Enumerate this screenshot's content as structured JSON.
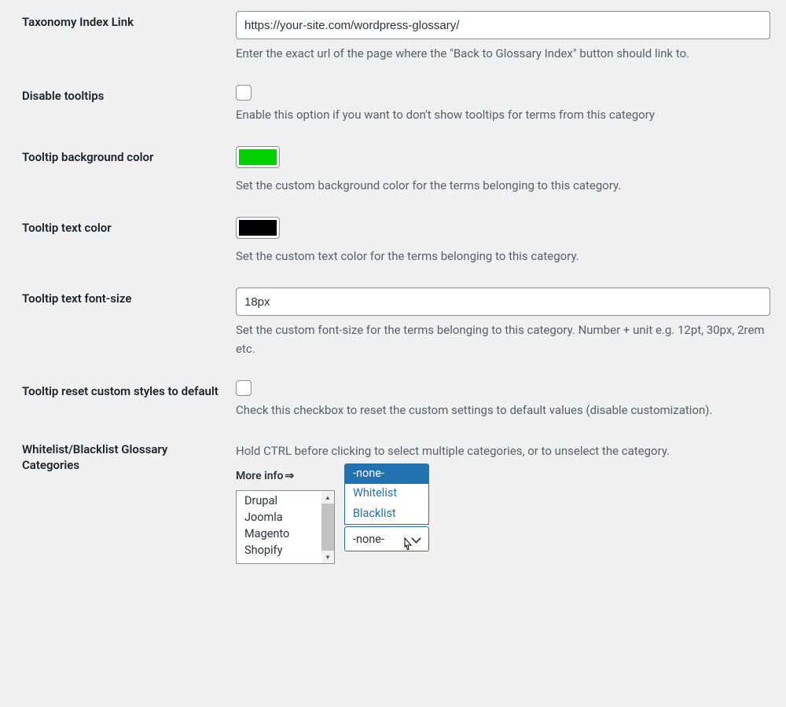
{
  "taxonomy_index": {
    "label": "Taxonomy Index Link",
    "value": "https://your-site.com/wordpress-glossary/",
    "desc": "Enter the exact url of the page where the \"Back to Glossary Index\" button should link to."
  },
  "disable_tooltips": {
    "label": "Disable tooltips",
    "desc": "Enable this option if you want to don't show tooltips for terms from this category"
  },
  "tooltip_bg": {
    "label": "Tooltip background color",
    "color": "#00d000",
    "desc": "Set the custom background color for the terms belonging to this category."
  },
  "tooltip_text": {
    "label": "Tooltip text color",
    "color": "#000000",
    "desc": "Set the custom text color for the terms belonging to this category."
  },
  "tooltip_font": {
    "label": "Tooltip text font-size",
    "value": "18px",
    "desc": "Set the custom font-size for the terms belonging to this category. Number + unit e.g. 12pt, 30px, 2rem etc."
  },
  "tooltip_reset": {
    "label": "Tooltip reset custom styles to default",
    "desc": "Check this checkbox to reset the custom settings to default values (disable customization)."
  },
  "whitelist": {
    "label": "Whitelist/Blacklist Glossary Categories",
    "desc": "Hold CTRL before clicking to select multiple categories, or to unselect the category.",
    "more_info": "More info",
    "categories": [
      "Drupal",
      "Joomla",
      "Magento",
      "Shopify"
    ],
    "mode_options": [
      "-none-",
      "Whitelist",
      "Blacklist"
    ],
    "mode_selected": "-none-"
  }
}
